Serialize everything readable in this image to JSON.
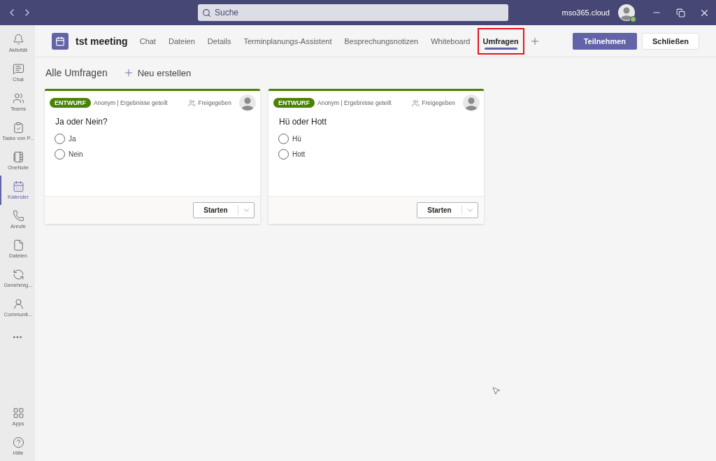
{
  "title_bar": {
    "search": {
      "placeholder": "Suche"
    },
    "account": "mso365.cloud"
  },
  "sidebar": {
    "items": [
      {
        "label": "Aktivität",
        "selected": false
      },
      {
        "label": "Chat",
        "selected": false
      },
      {
        "label": "Teams",
        "selected": false
      },
      {
        "label": "Tasks von P...",
        "selected": false
      },
      {
        "label": "OneNote",
        "selected": false
      },
      {
        "label": "Kalender",
        "selected": true
      },
      {
        "label": "Anrufe",
        "selected": false
      },
      {
        "label": "Dateien",
        "selected": false
      },
      {
        "label": "Genehmig...",
        "selected": false
      },
      {
        "label": "Communit...",
        "selected": false
      }
    ],
    "bottom_items": [
      {
        "label": "Apps",
        "selected": false
      },
      {
        "label": "Hilfe",
        "selected": false
      }
    ]
  },
  "header": {
    "title": "tst meeting",
    "tabs": [
      {
        "label": "Chat",
        "selected": false,
        "highlighted": false
      },
      {
        "label": "Dateien",
        "selected": false,
        "highlighted": false
      },
      {
        "label": "Details",
        "selected": false,
        "highlighted": false
      },
      {
        "label": "Terminplanungs-Assistent",
        "selected": false,
        "highlighted": false
      },
      {
        "label": "Besprechungsnotizen",
        "selected": false,
        "highlighted": false
      },
      {
        "label": "Whiteboard",
        "selected": false,
        "highlighted": false
      },
      {
        "label": "Umfragen",
        "selected": true,
        "highlighted": true
      }
    ],
    "buttons": {
      "join": "Teilnehmen",
      "close": "Schließen"
    }
  },
  "toolbar": {
    "title": "Alle Umfragen",
    "new": "Neu erstellen"
  },
  "polls": [
    {
      "status": "ENTWURF",
      "meta": "Anonym | Ergebnisse geteilt",
      "shared": "Freigegeben",
      "question": "Ja oder Nein?",
      "options": [
        {
          "label": "Ja",
          "selected": false
        },
        {
          "label": "Nein",
          "selected": false
        }
      ],
      "action": "Starten"
    },
    {
      "status": "ENTWURF",
      "meta": "Anonym | Ergebnisse geteilt",
      "shared": "Freigegeben",
      "question": "Hü oder Hott",
      "options": [
        {
          "label": "Hü",
          "selected": false
        },
        {
          "label": "Hott",
          "selected": false
        }
      ],
      "action": "Starten"
    }
  ]
}
